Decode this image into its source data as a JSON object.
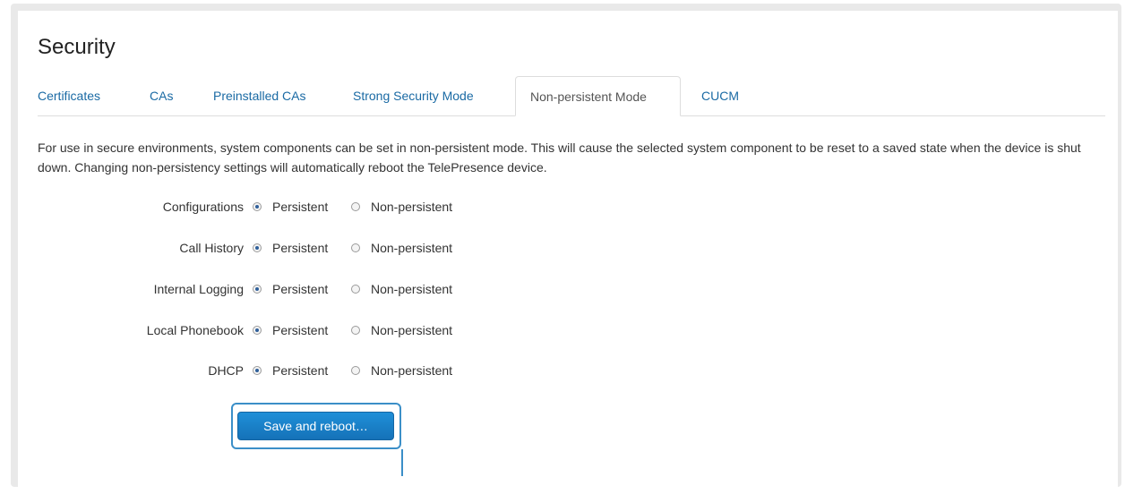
{
  "page": {
    "title": "Security",
    "tabs": [
      {
        "label": "Certificates",
        "active": false
      },
      {
        "label": "CAs",
        "active": false
      },
      {
        "label": "Preinstalled CAs",
        "active": false
      },
      {
        "label": "Strong Security Mode",
        "active": false
      },
      {
        "label": "Non-persistent Mode",
        "active": true
      },
      {
        "label": "CUCM",
        "active": false
      }
    ],
    "description": "For use in secure environments, system components can be set in non-persistent mode. This will cause the selected system component to be reset to a saved state when the device is shut down. Changing non-persistency settings will automatically reboot the TelePresence device.",
    "settings": [
      {
        "label": "Configurations",
        "persistent": "Persistent",
        "non_persistent": "Non-persistent",
        "selected": "persistent"
      },
      {
        "label": "Call History",
        "persistent": "Persistent",
        "non_persistent": "Non-persistent",
        "selected": "persistent"
      },
      {
        "label": "Internal Logging",
        "persistent": "Persistent",
        "non_persistent": "Non-persistent",
        "selected": "persistent"
      },
      {
        "label": "Local Phonebook",
        "persistent": "Persistent",
        "non_persistent": "Non-persistent",
        "selected": "persistent"
      },
      {
        "label": "DHCP",
        "persistent": "Persistent",
        "non_persistent": "Non-persistent",
        "selected": "persistent"
      }
    ],
    "save_button_label": "Save and reboot…"
  },
  "colors": {
    "link": "#1a6aa4",
    "button": "#1a80c8",
    "highlight": "#3b8fc8"
  }
}
